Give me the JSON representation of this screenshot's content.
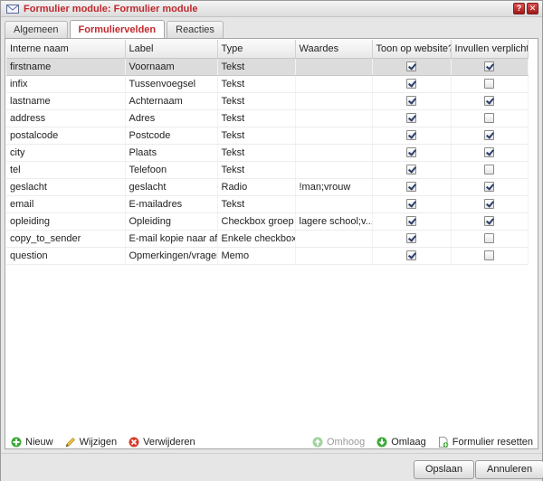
{
  "window": {
    "title": "Formulier module: Formulier module",
    "help_label": "?",
    "close_label": "✕"
  },
  "tabs": [
    {
      "label": "Algemeen",
      "active": false
    },
    {
      "label": "Formuliervelden",
      "active": true
    },
    {
      "label": "Reacties",
      "active": false
    }
  ],
  "table": {
    "columns": [
      "Interne naam",
      "Label",
      "Type",
      "Waardes",
      "Toon op website?",
      "Invullen verplicht?"
    ],
    "rows": [
      {
        "name": "firstname",
        "label": "Voornaam",
        "type": "Tekst",
        "values": "",
        "show": true,
        "required": true
      },
      {
        "name": "infix",
        "label": "Tussenvoegsel",
        "type": "Tekst",
        "values": "",
        "show": true,
        "required": false
      },
      {
        "name": "lastname",
        "label": "Achternaam",
        "type": "Tekst",
        "values": "",
        "show": true,
        "required": true
      },
      {
        "name": "address",
        "label": "Adres",
        "type": "Tekst",
        "values": "",
        "show": true,
        "required": false
      },
      {
        "name": "postalcode",
        "label": "Postcode",
        "type": "Tekst",
        "values": "",
        "show": true,
        "required": true
      },
      {
        "name": "city",
        "label": "Plaats",
        "type": "Tekst",
        "values": "",
        "show": true,
        "required": true
      },
      {
        "name": "tel",
        "label": "Telefoon",
        "type": "Tekst",
        "values": "",
        "show": true,
        "required": false
      },
      {
        "name": "geslacht",
        "label": "geslacht",
        "type": "Radio",
        "values": "!man;vrouw",
        "show": true,
        "required": true
      },
      {
        "name": "email",
        "label": "E-mailadres",
        "type": "Tekst",
        "values": "",
        "show": true,
        "required": true
      },
      {
        "name": "opleiding",
        "label": "Opleiding",
        "type": "Checkbox groep",
        "values": "lagere school;v...",
        "show": true,
        "required": true
      },
      {
        "name": "copy_to_sender",
        "label": "E-mail kopie naar afz...",
        "type": "Enkele checkbox",
        "values": "",
        "show": true,
        "required": false
      },
      {
        "name": "question",
        "label": "Opmerkingen/vragen",
        "type": "Memo",
        "values": "",
        "show": true,
        "required": false
      }
    ]
  },
  "toolbar": {
    "new_label": "Nieuw",
    "edit_label": "Wijzigen",
    "delete_label": "Verwijderen",
    "up_label": "Omhoog",
    "down_label": "Omlaag",
    "reset_label": "Formulier resetten"
  },
  "footer": {
    "save_label": "Opslaan",
    "cancel_label": "Annuleren"
  },
  "colors": {
    "accent": "#c0282d",
    "add": "#3aa935",
    "delete": "#d93a2b"
  }
}
